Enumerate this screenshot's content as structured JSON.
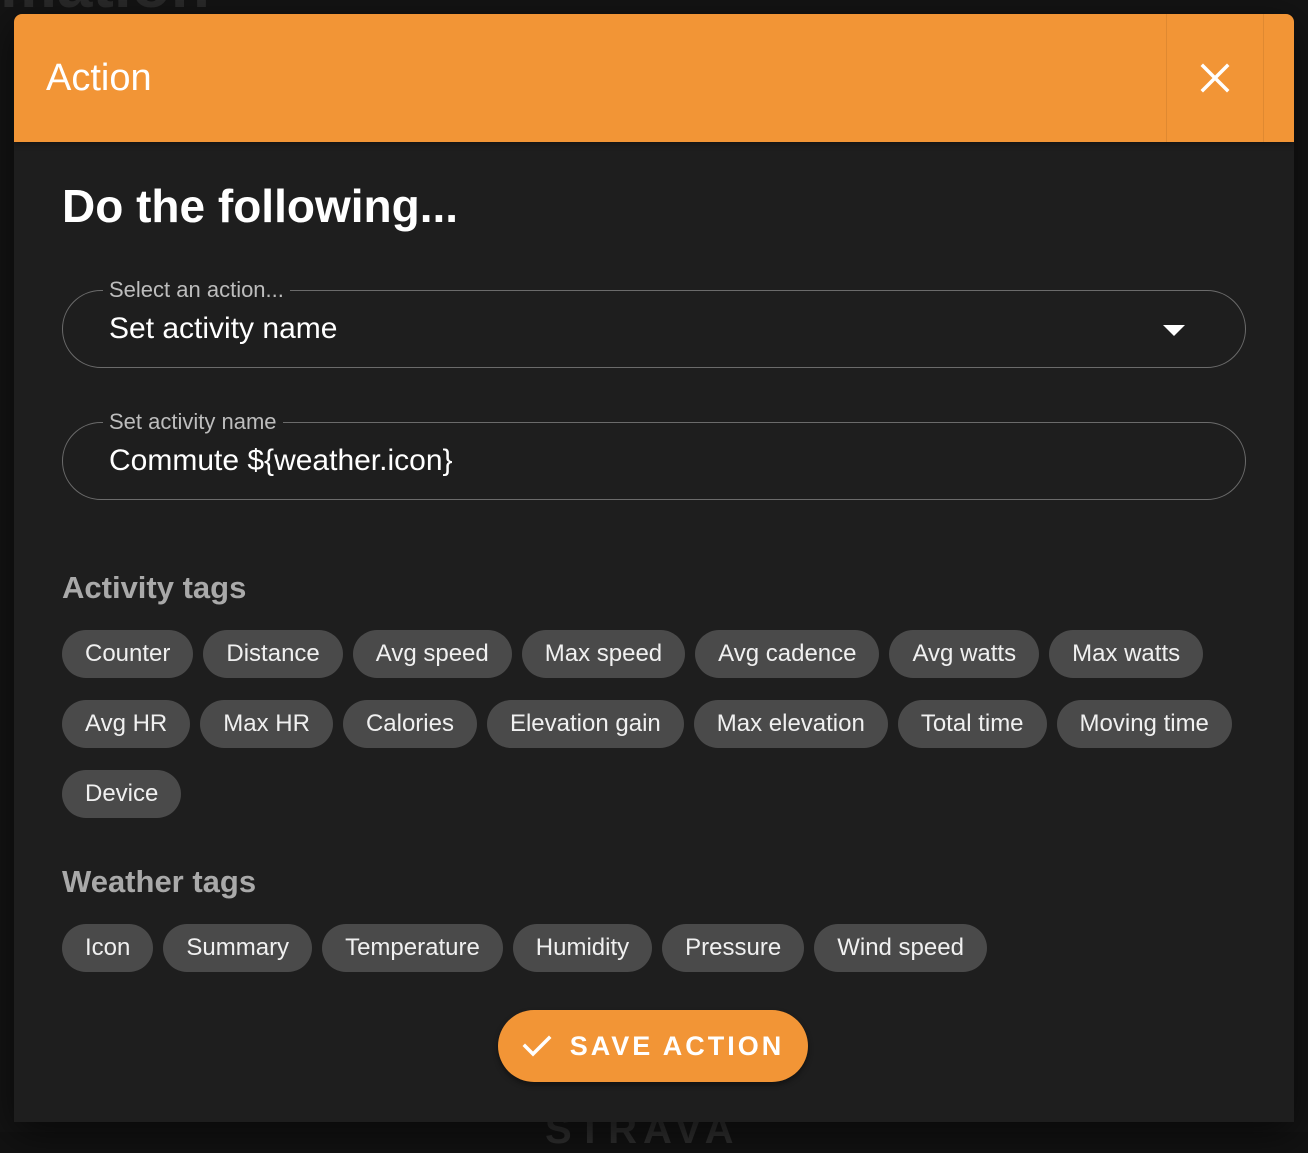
{
  "background": {
    "title_fragment": "mation",
    "brand_fragment": "STRAVA"
  },
  "dialog": {
    "title": "Action",
    "close_icon": "close-icon",
    "heading": "Do the following...",
    "action_select": {
      "label": "Select an action...",
      "value": "Set activity name"
    },
    "name_field": {
      "label": "Set activity name",
      "value": "Commute ${weather.icon}"
    },
    "activity_tags": {
      "title": "Activity tags",
      "items": [
        "Counter",
        "Distance",
        "Avg speed",
        "Max speed",
        "Avg cadence",
        "Avg watts",
        "Max watts",
        "Avg HR",
        "Max HR",
        "Calories",
        "Elevation gain",
        "Max elevation",
        "Total time",
        "Moving time",
        "Device"
      ]
    },
    "weather_tags": {
      "title": "Weather tags",
      "items": [
        "Icon",
        "Summary",
        "Temperature",
        "Humidity",
        "Pressure",
        "Wind speed"
      ]
    },
    "save_button": {
      "label": "SAVE ACTION",
      "icon": "check-icon"
    }
  },
  "colors": {
    "accent": "#f29536",
    "surface": "#1e1e1e",
    "chip": "#4a4a4a"
  }
}
